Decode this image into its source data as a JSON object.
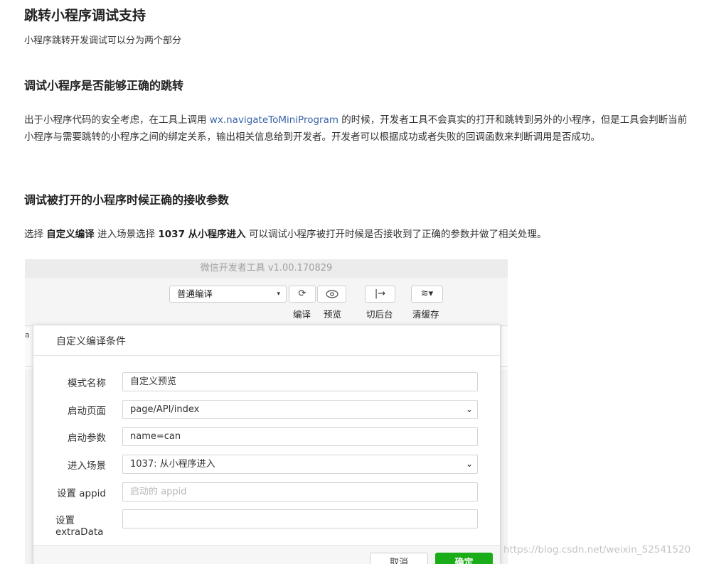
{
  "article": {
    "title": "跳转小程序调试支持",
    "intro": "小程序跳转开发调试可以分为两个部分",
    "section1": {
      "heading": "调试小程序是否能够正确的跳转",
      "p_before": "出于小程序代码的安全考虑，在工具上调用 ",
      "p_code": "wx.navigateToMiniProgram",
      "p_after": " 的时候，开发者工具不会真实的打开和跳转到另外的小程序，但是工具会判断当前小程序与需要跳转的小程序之间的绑定关系，输出相关信息给到开发者。开发者可以根据成功或者失败的回调函数来判断调用是否成功。"
    },
    "section2": {
      "heading": "调试被打开的小程序时候正确的接收参数",
      "p_1": "选择 ",
      "p_bold1": "自定义编译",
      "p_2": " 进入场景选择 ",
      "p_bold2": "1037 从小程序进入",
      "p_3": " 可以调试小程序被打开时候是否接收到了正确的参数并做了相关处理。"
    }
  },
  "screenshot": {
    "window_title": "微信开发者工具 v1.00.170829",
    "toolbar": {
      "mode_value": "普通编译",
      "compile_label": "编译",
      "preview_label": "预览",
      "background_label": "切后台",
      "clear_cache_label": "清缓存"
    },
    "behind_char": "a",
    "dialog": {
      "title": "自定义编译条件",
      "mode_name_label": "模式名称",
      "mode_name_value": "自定义预览",
      "start_page_label": "启动页面",
      "start_page_value": "page/API/index",
      "start_params_label": "启动参数",
      "start_params_value": "name=can",
      "scene_label": "进入场景",
      "scene_value": "1037: 从小程序进入",
      "appid_label": "设置 appid",
      "appid_placeholder": "启动的 appid",
      "extradata_label": "设置 extraData",
      "extradata_value": "",
      "cancel_label": "取消",
      "ok_label": "确定"
    }
  },
  "watermark": "https://blog.csdn.net/weixin_52541520",
  "colors": {
    "link": "#3a64a8",
    "ok_button": "#1aad19"
  }
}
